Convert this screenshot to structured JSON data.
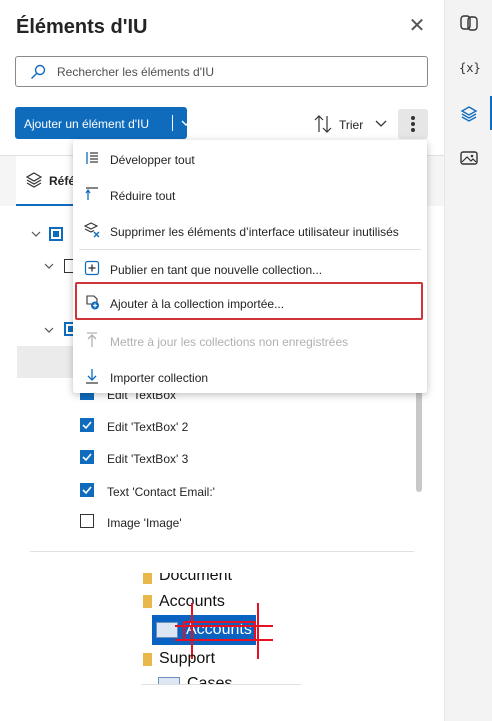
{
  "header": {
    "title": "Éléments d'IU",
    "close_icon": "close-icon"
  },
  "search": {
    "placeholder": "Rechercher les éléments d'IU"
  },
  "toolbar": {
    "add_label": "Ajouter un élément d'IU",
    "sort_label": "Trier"
  },
  "tabs": [
    {
      "label": "Référentiel",
      "icon": "layers-icon"
    }
  ],
  "tree": {
    "items": [
      {
        "label": "Edit 'TextBox'",
        "checked": true
      },
      {
        "label": "Edit 'TextBox' 2",
        "checked": true
      },
      {
        "label": "Edit 'TextBox' 3",
        "checked": true
      },
      {
        "label": "Text 'Contact Email:'",
        "checked": true
      },
      {
        "label": "Image 'Image'",
        "checked": false
      }
    ]
  },
  "preview": {
    "rows": [
      "Document",
      "Accounts",
      "Accounts",
      "Support",
      "Cases"
    ]
  },
  "menu": {
    "items": [
      {
        "label": "Développer tout",
        "icon": "expand-all-icon",
        "disabled": false
      },
      {
        "label": "Réduire tout",
        "icon": "collapse-all-icon",
        "disabled": false
      },
      {
        "label": "Supprimer les éléments d’interface utilisateur inutilisés",
        "icon": "remove-unused-icon",
        "disabled": false
      },
      {
        "label": "Publier en tant que nouvelle collection...",
        "icon": "publish-icon",
        "disabled": false
      },
      {
        "label": "Ajouter à la collection importée...",
        "icon": "add-to-collection-icon",
        "disabled": false
      },
      {
        "label": "Mettre à jour les collections non enregistrées",
        "icon": "update-icon",
        "disabled": true
      },
      {
        "label": "Importer collection",
        "icon": "import-icon",
        "disabled": false
      }
    ]
  },
  "rail": {
    "icons": [
      "copilot-icon",
      "variables-icon",
      "ui-elements-icon",
      "images-icon"
    ],
    "variables_label": "{x}"
  },
  "colors": {
    "accent": "#0f6cbd",
    "highlight": "#d13438"
  }
}
